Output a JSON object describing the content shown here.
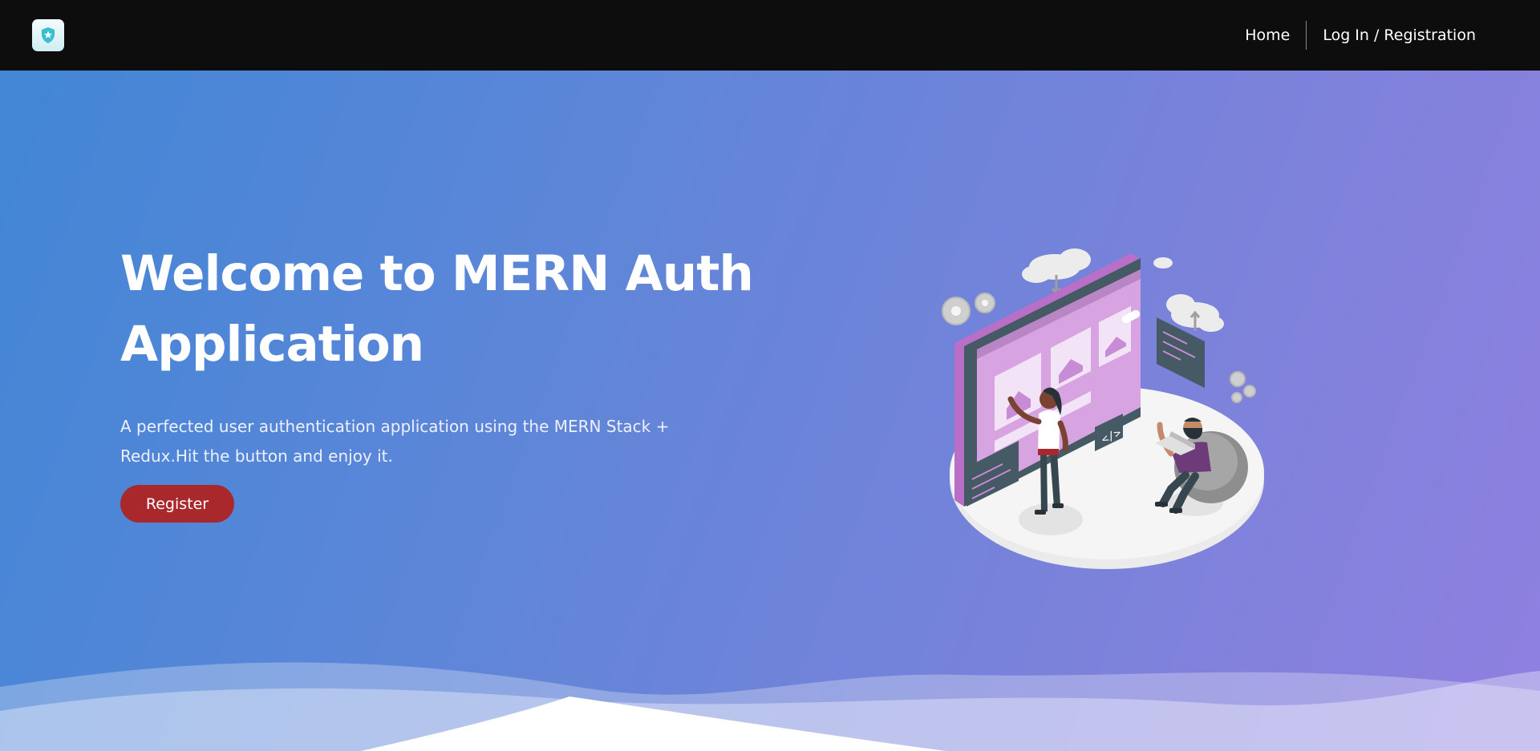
{
  "nav": {
    "logo_icon": "shield-star-icon",
    "links": [
      {
        "label": "Home"
      },
      {
        "label": "Log In / Registration"
      }
    ]
  },
  "hero": {
    "title_line1": "Welcome to MERN Auth",
    "title_line2": "Application",
    "subtitle_line1": "A perfected user authentication application using the MERN Stack +",
    "subtitle_line2": "Redux.Hit the button and enjoy it.",
    "register_label": "Register",
    "illustration_icon": "developers-illustration"
  },
  "colors": {
    "navbar_bg": "#0d0d0d",
    "gradient_start": "#4286d6",
    "gradient_end": "#8f80e0",
    "button_bg": "#a8282b",
    "text": "#ffffff"
  }
}
